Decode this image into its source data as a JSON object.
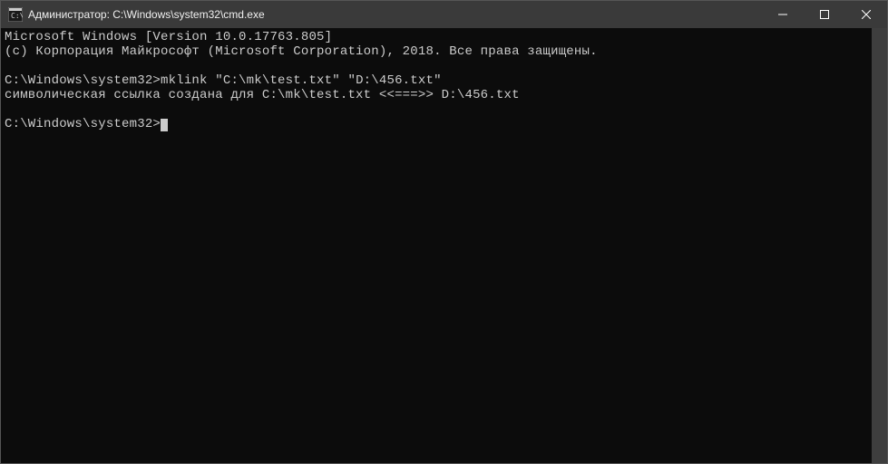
{
  "window": {
    "title": "Администратор: C:\\Windows\\system32\\cmd.exe"
  },
  "terminal": {
    "line1": "Microsoft Windows [Version 10.0.17763.805]",
    "line2": "(c) Корпорация Майкрософт (Microsoft Corporation), 2018. Все права защищены.",
    "blank1": "",
    "prompt1": "C:\\Windows\\system32>",
    "command1": "mklink \"C:\\mk\\test.txt\" \"D:\\456.txt\"",
    "output1": "символическая ссылка создана для C:\\mk\\test.txt <<===>> D:\\456.txt",
    "blank2": "",
    "prompt2": "C:\\Windows\\system32>"
  }
}
